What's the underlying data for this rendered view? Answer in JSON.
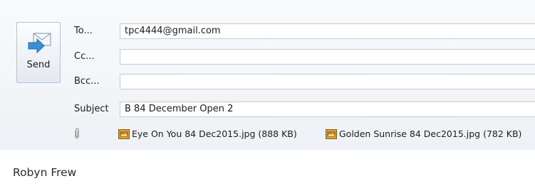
{
  "compose": {
    "send_label": "Send",
    "to_label": "To...",
    "cc_label": "Cc...",
    "bcc_label": "Bcc...",
    "subject_label": "Subject",
    "to_value": "tpc4444@gmail.com",
    "cc_value": "",
    "bcc_value": "",
    "subject_value": "B 84 December Open 2"
  },
  "attachments": [
    {
      "icon": "jpg-file-icon",
      "label": "Eye On You 84 Dec2015.jpg (888 KB)"
    },
    {
      "icon": "jpg-file-icon",
      "label": "Golden Sunrise 84 Dec2015.jpg (782 KB)"
    }
  ],
  "body": {
    "signature": "Robyn Frew"
  },
  "colors": {
    "header_bg": "#eef1f5",
    "field_border": "#c3cbd5",
    "jpg_icon": "#b07a1c"
  }
}
